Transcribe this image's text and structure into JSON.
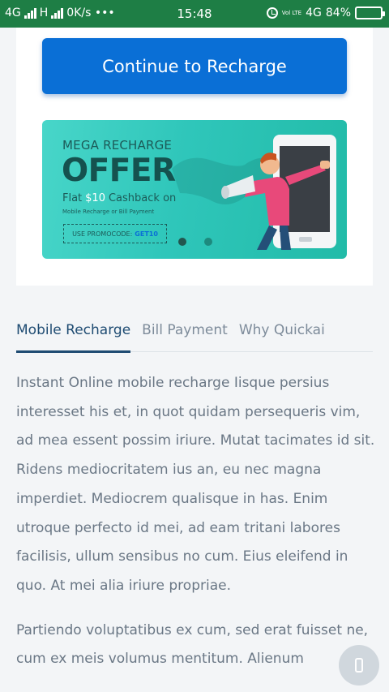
{
  "status_bar": {
    "left_text_1": "4G",
    "left_text_2": "H",
    "speed": "0K/s •••",
    "time": "15:48",
    "volte": "Vol LTE",
    "network": "4G",
    "battery": "84%",
    "battery_level": 0.84
  },
  "card": {
    "recharge_button_label": "Continue to Recharge"
  },
  "banner": {
    "subtitle": "MEGA RECHARGE",
    "title": "OFFER",
    "flat": "Flat",
    "amount": "$10",
    "cashback": "Cashback on",
    "fine_print": "Mobile Recharge or Bill Payment",
    "promo_label": "USE PROMOCODE:",
    "promo_code": "GET10",
    "active_dot": 0,
    "colors": {
      "accent": "#0a6fd6",
      "banner_start": "#48d6c9",
      "banner_end": "#22bba8"
    }
  },
  "tabs": [
    {
      "label": "Mobile Recharge",
      "active": true
    },
    {
      "label": "Bill Payment",
      "active": false
    },
    {
      "label": "Why Quickai",
      "active": false
    }
  ],
  "content": {
    "paragraph_1": "Instant Online mobile recharge Iisque persius interesset his et, in quot quidam persequeris vim, ad mea essent possim iriure. Mutat tacimates id sit. Ridens mediocritatem ius an, eu nec magna imperdiet. Mediocrem qualisque in has. Enim utroque perfecto id mei, ad eam tritani labores facilisis, ullum sensibus no cum. Eius eleifend in quo. At mei alia iriure propriae.",
    "paragraph_2": "Partiendo voluptatibus ex cum, sed erat fuisset ne, cum ex meis volumus mentitum. Alienum"
  },
  "fab": {
    "icon": "phone-icon"
  }
}
